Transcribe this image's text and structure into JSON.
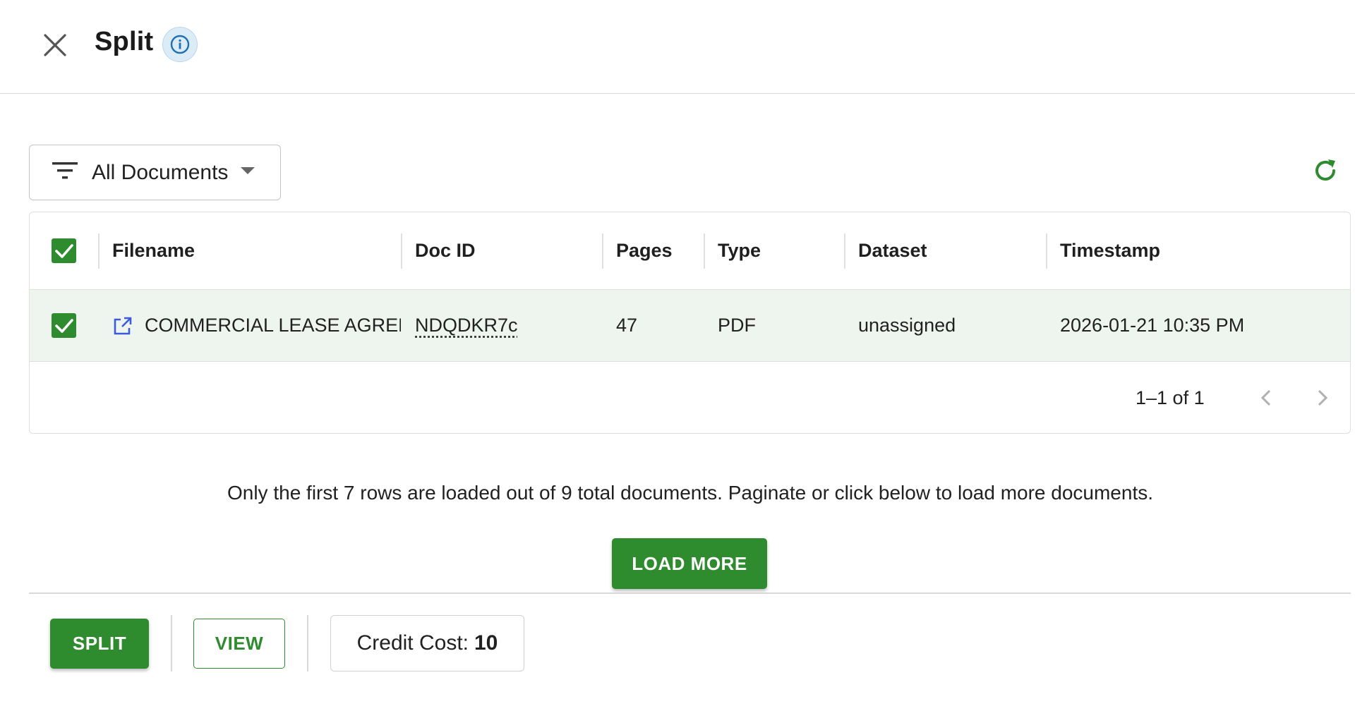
{
  "header": {
    "title": "Split",
    "close_icon": "close-icon",
    "info_icon": "info-icon"
  },
  "toolbar": {
    "filter_label": "All Documents",
    "filter_icon": "filter-icon",
    "refresh_icon": "refresh-icon"
  },
  "table": {
    "columns": [
      "Filename",
      "Doc ID",
      "Pages",
      "Type",
      "Dataset",
      "Timestamp"
    ],
    "header_checked": true,
    "rows": [
      {
        "checked": true,
        "filename": "COMMERCIAL LEASE AGREEMENT",
        "doc_id": "NDQDKR7c",
        "pages": "47",
        "type": "PDF",
        "dataset": "unassigned",
        "timestamp": "2026-01-21 10:35 PM"
      }
    ],
    "pagination": "1–1 of 1"
  },
  "notice": "Only the first 7 rows are loaded out of 9 total documents. Paginate or click below to load more documents.",
  "load_more_label": "LOAD MORE",
  "actions": {
    "split_label": "SPLIT",
    "view_label": "VIEW",
    "credit_label": "Credit Cost:",
    "credit_value": "10"
  },
  "colors": {
    "accent": "#2e8b2e",
    "selected_row": "#eef5ee",
    "info_bg": "#dcecf7",
    "link_icon": "#3b5bdb"
  }
}
